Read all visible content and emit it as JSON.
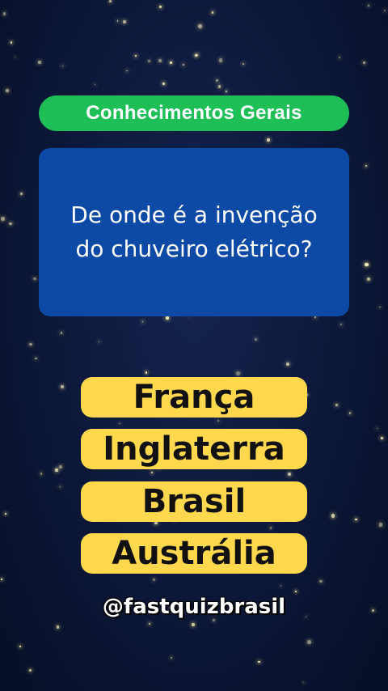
{
  "quiz": {
    "category": "Conhecimentos Gerais",
    "question_line1": "De onde é a invenção",
    "question_line2": "do chuveiro elétrico?",
    "answers": [
      "França",
      "Inglaterra",
      "Brasil",
      "Austrália"
    ],
    "handle": "@fastquizbrasil"
  },
  "colors": {
    "background": "#0c1738",
    "category_bg": "#1fbf58",
    "question_bg": "#0d4aa6",
    "answer_bg": "#ffd84d",
    "star": "#fff7c0"
  }
}
